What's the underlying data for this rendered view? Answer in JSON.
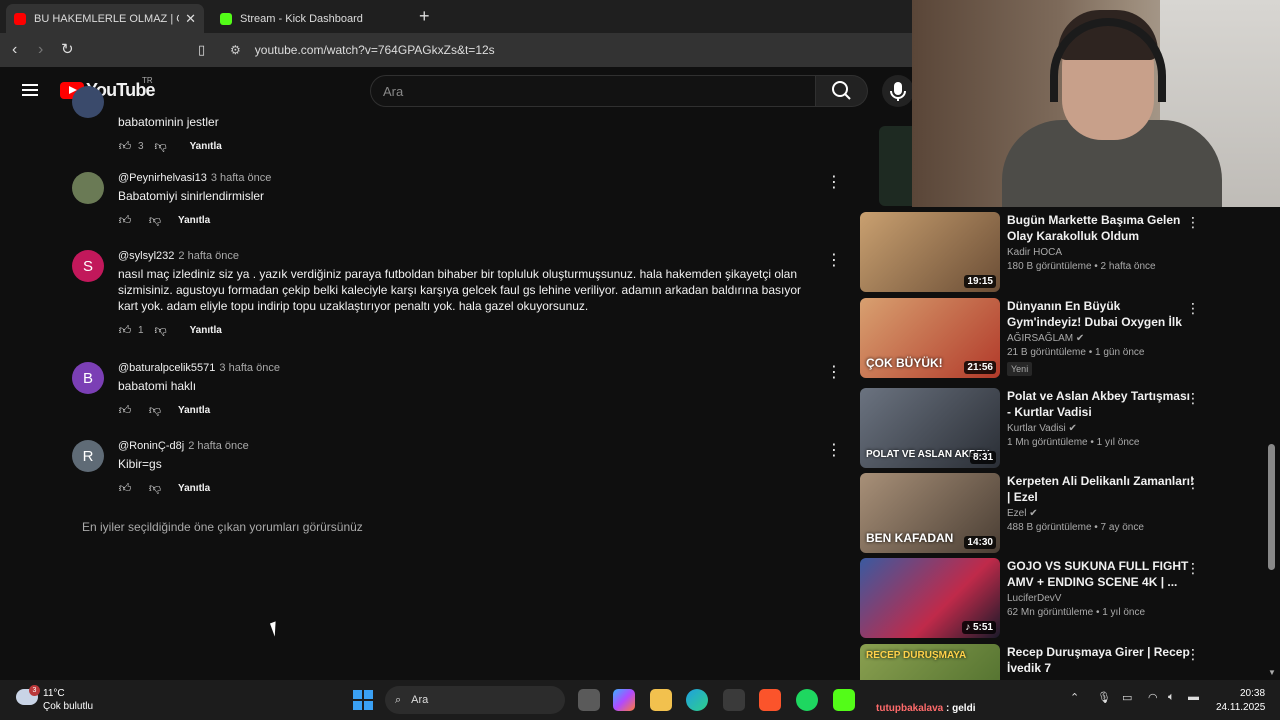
{
  "browser": {
    "tabs": [
      {
        "title": "BU HAKEMLERLE OLMAZ | GALA",
        "active": true,
        "favicon_color": "#ff0000"
      },
      {
        "title": "Stream - Kick Dashboard",
        "active": false,
        "favicon_color": "#53fc18"
      }
    ],
    "url": "youtube.com/watch?v=764GPAGkxZs&t=12s"
  },
  "youtube": {
    "logo_text": "YouTube",
    "country_code": "TR",
    "search_placeholder": "Ara"
  },
  "comments": [
    {
      "author": "",
      "time": "",
      "text": "babatominin jestler",
      "likes": "3",
      "reply_label": "Yanıtla",
      "avatar_letter": "",
      "avatar_color": "#3a4a6b"
    },
    {
      "author": "@Peynirhelvasi13",
      "time": "3 hafta önce",
      "text": "Babatomiyi sinirlendirmisler",
      "likes": "",
      "reply_label": "Yanıtla",
      "avatar_letter": "",
      "avatar_color": "#6a7a55"
    },
    {
      "author": "@sylsyl232",
      "time": "2 hafta önce",
      "text": "nasıl maç izlediniz siz ya . yazık verdiğiniz paraya futboldan bihaber bir topluluk oluşturmuşsunuz. hala hakemden şikayetçi olan sizmisiniz. agustoyu formadan çekip belki kaleciyle karşı karşıya gelcek faul gs lehine veriliyor. adamın arkadan baldırına basıyor kart yok. adam eliyle topu indirip topu uzaklaştırıyor penaltı yok. hala gazel okuyorsunuz.",
      "likes": "1",
      "reply_label": "Yanıtla",
      "avatar_letter": "S",
      "avatar_color": "#c2185b"
    },
    {
      "author": "@baturalpcelik5571",
      "time": "3 hafta önce",
      "text": "babatomi haklı",
      "likes": "",
      "reply_label": "Yanıtla",
      "avatar_letter": "B",
      "avatar_color": "#7b3fb5"
    },
    {
      "author": "@RoninÇ-d8j",
      "time": "2 hafta önce",
      "text": "Kibir=gs",
      "likes": "",
      "reply_label": "Yanıtla",
      "avatar_letter": "R",
      "avatar_color": "#5f6b76"
    }
  ],
  "comments_footer": "En iyiler seçildiğinde öne çıkan yorumları görürsünüz",
  "recommendations": [
    {
      "title": "Bugün Markette Başıma Gelen Olay Karakolluk Oldum",
      "channel": "Kadir HOCA",
      "verified": false,
      "meta": "180 B görüntüleme • 2 hafta önce",
      "duration": "19:15",
      "badge": "",
      "thumb_label": "",
      "thumb_color": "#8a6a4a"
    },
    {
      "title": "Dünyanın En Büyük Gym'indeyiz! Dubai Oxygen İlk Kez...",
      "channel": "AĞIRSAĞLAM",
      "verified": true,
      "meta": "21 B görüntüleme • 1 gün önce",
      "duration": "21:56",
      "badge": "Yeni",
      "thumb_label": "ÇOK BÜYÜK!",
      "thumb_color": "#b24a3a"
    },
    {
      "title": "Polat ve Aslan Akbey Tartışması - Kurtlar Vadisi",
      "channel": "Kurtlar Vadisi",
      "verified": true,
      "meta": "1 Mn görüntüleme • 1 yıl önce",
      "duration": "8:31",
      "badge": "",
      "thumb_label": "POLAT VE ASLAN AKBEY",
      "thumb_color": "#4a4f5a"
    },
    {
      "title": "Kerpeten Ali Delikanlı Zamanları! | Ezel",
      "channel": "Ezel",
      "verified": true,
      "meta": "488 B görüntüleme • 7 ay önce",
      "duration": "14:30",
      "badge": "",
      "thumb_label": "BEN KAFADAN",
      "thumb_color": "#7a6a5a"
    },
    {
      "title": "GOJO VS SUKUNA FULL FIGHT AMV + ENDING SCENE 4K | ...",
      "channel": "LuciferDevV",
      "verified": false,
      "meta": "62 Mn görüntüleme • 1 yıl önce",
      "duration": "♪ 5:51",
      "badge": "",
      "thumb_label": "",
      "thumb_color": "#3a2a6a"
    },
    {
      "title": "Recep Duruşmaya Girer | Recep İvedik 7",
      "channel": "",
      "verified": false,
      "meta": "",
      "duration": "",
      "badge": "",
      "thumb_label": "RECEP DURUŞMAYA",
      "thumb_color": "#6a8a3a"
    }
  ],
  "taskbar": {
    "weather_temp": "11°C",
    "weather_cond": "Çok bulutlu",
    "weather_badge": "3",
    "search_label": "Ara",
    "ticker_user": "tutupbakalava",
    "ticker_text": " : geldi",
    "time": "20:38",
    "date": "24.11.2025"
  }
}
